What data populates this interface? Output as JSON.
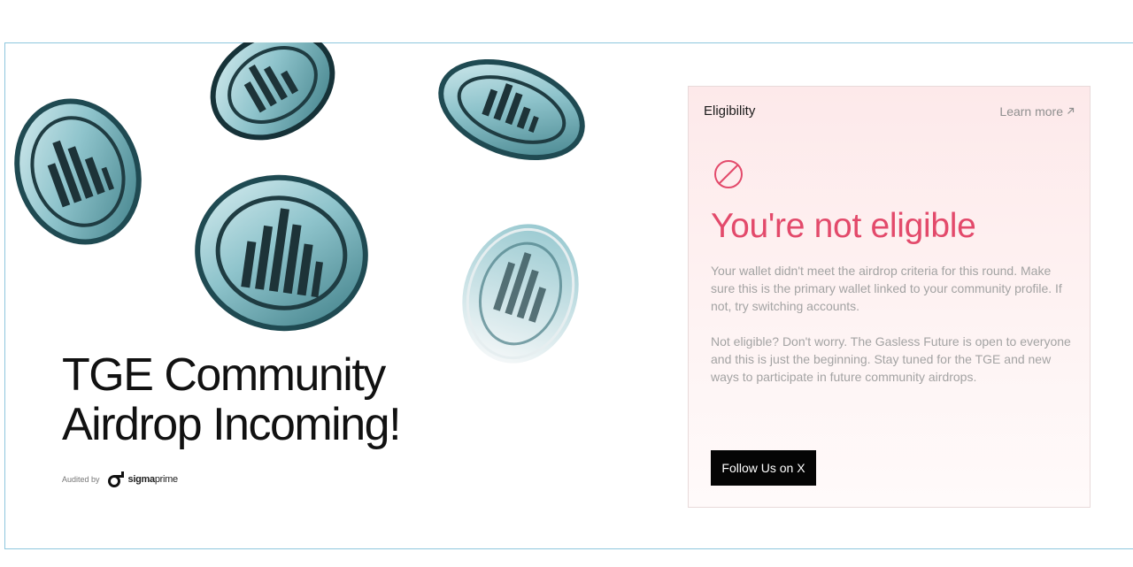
{
  "hero": {
    "headline_line1": "TGE Community",
    "headline_line2": "Airdrop Incoming!",
    "audited_label": "Audited by",
    "auditor_bold": "sigma",
    "auditor_light": "prime"
  },
  "card": {
    "title": "Eligibility",
    "learn_more": "Learn more",
    "status_icon": "prohibited-icon",
    "heading": "You're not eligible",
    "paragraph1": "Your wallet didn't meet the airdrop criteria for this round. Make sure this is the primary wallet linked to your community profile. If not, try switching accounts.",
    "paragraph2": "Not eligible? Don't worry. The Gasless Future is open to everyone and this is just the beginning. Stay tuned for the TGE and new ways to participate in future community airdrops.",
    "button_label": "Follow Us on X"
  },
  "colors": {
    "accent": "#e34a6b",
    "button_bg": "#050505",
    "frame_border": "#8ec7dd",
    "coin_metal": "#8fc4cc"
  },
  "icons": [
    "coin-icon",
    "prohibited-icon",
    "arrow-up-right-icon",
    "sigma-prime-logo"
  ]
}
